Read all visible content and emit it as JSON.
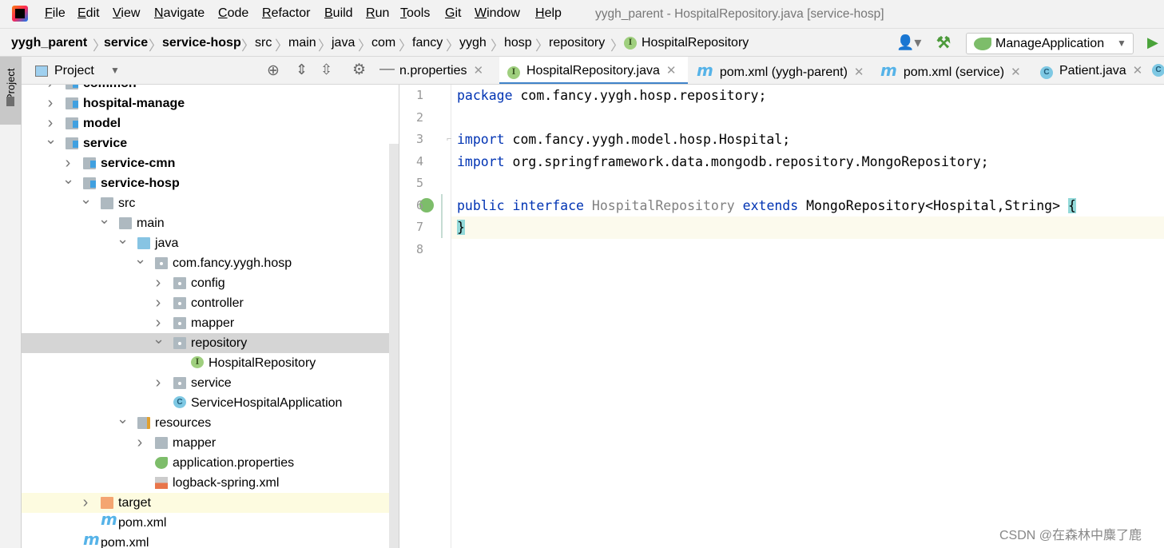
{
  "menu": {
    "items": [
      "File",
      "Edit",
      "View",
      "Navigate",
      "Code",
      "Refactor",
      "Build",
      "Run",
      "Tools",
      "Git",
      "Window",
      "Help"
    ],
    "title": "yygh_parent - HospitalRepository.java [service-hosp]"
  },
  "breadcrumb": {
    "items": [
      "yygh_parent",
      "service",
      "service-hosp",
      "src",
      "main",
      "java",
      "com",
      "fancy",
      "yygh",
      "hosp",
      "repository",
      "HospitalRepository"
    ]
  },
  "toolbar": {
    "run_config": "ManageApplication"
  },
  "side_stripe": {
    "label": "Project"
  },
  "project_panel": {
    "title": "Project",
    "tree": [
      {
        "label": "common",
        "level": 0,
        "chev": ">",
        "icon": "module",
        "bold": true
      },
      {
        "label": "hospital-manage",
        "level": 0,
        "chev": ">",
        "icon": "module",
        "bold": true
      },
      {
        "label": "model",
        "level": 0,
        "chev": ">",
        "icon": "module",
        "bold": true
      },
      {
        "label": "service",
        "level": 0,
        "chev": "v",
        "icon": "module",
        "bold": true
      },
      {
        "label": "service-cmn",
        "level": 1,
        "chev": ">",
        "icon": "module",
        "bold": true
      },
      {
        "label": "service-hosp",
        "level": 1,
        "chev": "v",
        "icon": "module",
        "bold": true
      },
      {
        "label": "src",
        "level": 2,
        "chev": "v",
        "icon": "folder"
      },
      {
        "label": "main",
        "level": 3,
        "chev": "v",
        "icon": "folder"
      },
      {
        "label": "java",
        "level": 4,
        "chev": "v",
        "icon": "source-folder"
      },
      {
        "label": "com.fancy.yygh.hosp",
        "level": 5,
        "chev": "v",
        "icon": "package"
      },
      {
        "label": "config",
        "level": 6,
        "chev": ">",
        "icon": "package"
      },
      {
        "label": "controller",
        "level": 6,
        "chev": ">",
        "icon": "package"
      },
      {
        "label": "mapper",
        "level": 6,
        "chev": ">",
        "icon": "package"
      },
      {
        "label": "repository",
        "level": 6,
        "chev": "v",
        "icon": "package",
        "selected": true
      },
      {
        "label": "HospitalRepository",
        "level": 7,
        "chev": "",
        "icon": "interface"
      },
      {
        "label": "service",
        "level": 6,
        "chev": ">",
        "icon": "package"
      },
      {
        "label": "ServiceHospitalApplication",
        "level": 6,
        "chev": "",
        "icon": "spring-class"
      },
      {
        "label": "resources",
        "level": 4,
        "chev": "v",
        "icon": "resources-folder"
      },
      {
        "label": "mapper",
        "level": 5,
        "chev": ">",
        "icon": "folder"
      },
      {
        "label": "application.properties",
        "level": 5,
        "chev": "",
        "icon": "spring-properties"
      },
      {
        "label": "logback-spring.xml",
        "level": 5,
        "chev": "",
        "icon": "xml-file"
      },
      {
        "label": "target",
        "level": 2,
        "chev": ">",
        "icon": "excluded-folder",
        "highlight": true
      },
      {
        "label": "pom.xml",
        "level": 2,
        "chev": "",
        "icon": "maven"
      },
      {
        "label": "pom.xml",
        "level": 1,
        "chev": "",
        "icon": "maven"
      }
    ]
  },
  "tabs": [
    {
      "label": "n.properties",
      "icon": "",
      "active": false
    },
    {
      "label": "HospitalRepository.java",
      "icon": "interface",
      "active": true
    },
    {
      "label": "pom.xml (yygh-parent)",
      "icon": "maven",
      "active": false
    },
    {
      "label": "pom.xml (service)",
      "icon": "maven",
      "active": false
    },
    {
      "label": "Patient.java",
      "icon": "class",
      "active": false
    }
  ],
  "editor": {
    "line_numbers": [
      "1",
      "2",
      "3",
      "4",
      "5",
      "6",
      "7",
      "8"
    ],
    "lines": {
      "l1": {
        "kw": "package",
        "rest": " com.fancy.yygh.hosp.repository;"
      },
      "l3": {
        "kw": "import",
        "rest": " com.fancy.yygh.model.hosp.Hospital;"
      },
      "l4": {
        "kw": "import",
        "rest": " org.springframework.data.mongodb.repository.MongoRepository;"
      },
      "l6": {
        "kw1": "public",
        "kw2": "interface",
        "name": "HospitalRepository",
        "kw3": "extends",
        "rest": " MongoRepository<Hospital,String> ",
        "brace": "{"
      },
      "l7": {
        "brace": "}"
      }
    },
    "current_line": "7"
  },
  "watermark": "CSDN @在森林中麋了鹿"
}
